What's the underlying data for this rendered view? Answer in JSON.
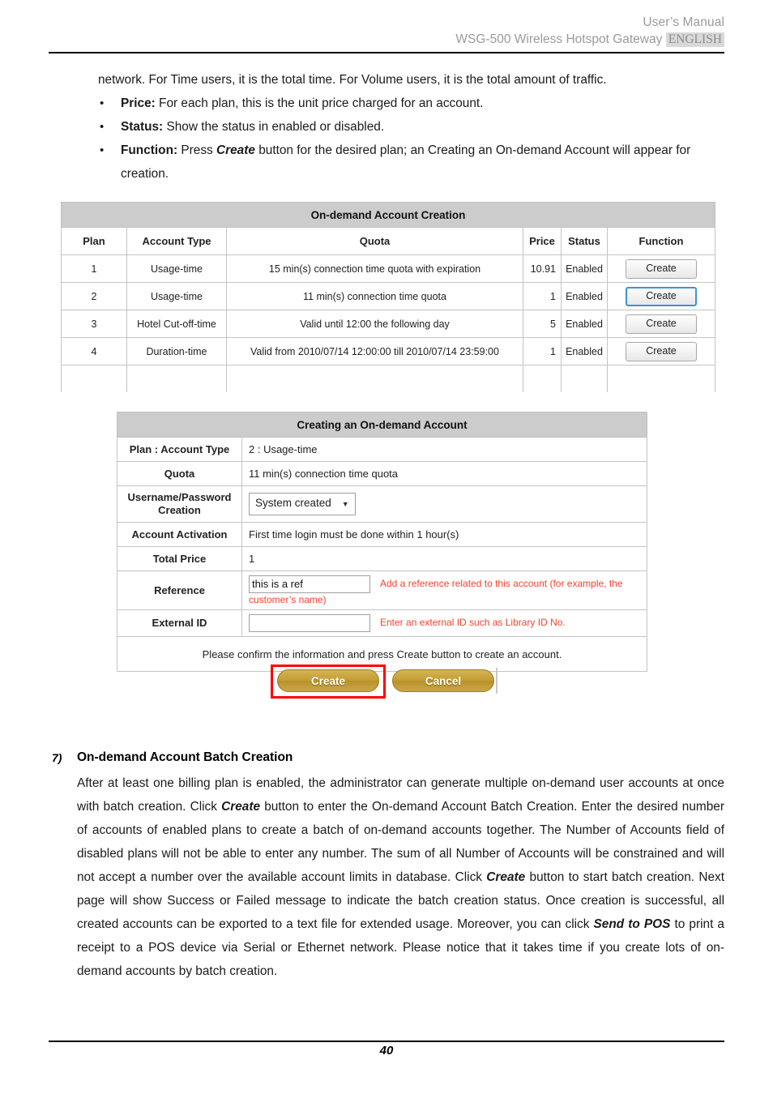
{
  "header": {
    "line1": "User’s Manual",
    "line2_product": "WSG-500 Wireless Hotspot Gateway",
    "language_badge": "ENGLISH"
  },
  "intro": {
    "continuation": "network. For Time users, it is the total time. For Volume users, it is the total amount of traffic.",
    "bullets": [
      {
        "marker": "•",
        "term": "Price:",
        "text": " For each plan, this is the unit price charged for an account."
      },
      {
        "marker": "•",
        "term": "Status:",
        "text": " Show the status in enabled or disabled."
      }
    ],
    "function_bullet": {
      "marker": "•",
      "term": "Function:",
      "part1": " Press ",
      "emphasis": "Create",
      "part2": " button for the desired plan; an Creating an On-demand Account will appear for creation."
    }
  },
  "table_ondemand": {
    "title": "On-demand Account Creation",
    "columns": [
      "Plan",
      "Account Type",
      "Quota",
      "Price",
      "Status",
      "Function"
    ],
    "rows": [
      {
        "plan": "1",
        "account_type": "Usage-time",
        "quota": "15 min(s) connection time quota with expiration",
        "price": "10.91",
        "status": "Enabled",
        "function": "Create",
        "focused": false
      },
      {
        "plan": "2",
        "account_type": "Usage-time",
        "quota": "11 min(s) connection time quota",
        "price": "1",
        "status": "Enabled",
        "function": "Create",
        "focused": true
      },
      {
        "plan": "3",
        "account_type": "Hotel Cut-off-time",
        "quota": "Valid until 12:00 the following day",
        "price": "5",
        "status": "Enabled",
        "function": "Create",
        "focused": false
      },
      {
        "plan": "4",
        "account_type": "Duration-time",
        "quota": "Valid from 2010/07/14 12:00:00 till 2010/07/14 23:59:00",
        "price": "1",
        "status": "Enabled",
        "function": "Create",
        "focused": false
      }
    ]
  },
  "table_creating": {
    "title": "Creating an On-demand Account",
    "fields": {
      "plan_account_type_label": "Plan : Account Type",
      "plan_account_type_value": "2 : Usage-time",
      "quota_label": "Quota",
      "quota_value": "11 min(s) connection time quota",
      "username_password_label": "Username/Password Creation",
      "username_password_value": "System created",
      "account_activation_label": "Account Activation",
      "account_activation_value": "First time login must be done within 1 hour(s)",
      "total_price_label": "Total Price",
      "total_price_value": "1",
      "reference_label": "Reference",
      "reference_value": "this is a ref",
      "reference_hint": "Add a reference related to this account (for example, the customer’s name)",
      "external_id_label": "External ID",
      "external_id_value": "",
      "external_id_hint": "Enter an external ID such as Library ID No."
    },
    "confirm_note": "Please confirm the information and press Create button to create an account."
  },
  "action_buttons": {
    "create": "Create",
    "cancel": "Cancel",
    "highlight_color": "#ff0000",
    "button_color": "#c49e33"
  },
  "section": {
    "number": "7)",
    "heading": "On-demand Account Batch Creation",
    "paragraph_part1": "After at least one billing plan is enabled, the administrator can generate multiple on-demand user accounts at once with batch creation. Click ",
    "emphasis1": "Create",
    "paragraph_part2": " button to enter the On-demand Account Batch Creation. Enter the desired number of accounts of enabled plans to create a batch of on-demand accounts together. The Number of Accounts field of disabled plans will not be able to enter any number. The sum of all Number of Accounts will be constrained and will not accept a number over the available account limits in database. Click ",
    "emphasis2": "Create",
    "paragraph_part3": " button to start batch creation. Next page will show Success or Failed message to indicate the batch creation status. Once creation is successful, all created accounts can be exported to a text file for extended usage. Moreover, you can click ",
    "emphasis3": "Send to POS",
    "paragraph_part4": " to print a receipt to a POS device via Serial or Ethernet network. Please notice that it takes time if you create lots of on-demand accounts by batch creation."
  },
  "footer": {
    "page_number": "40"
  }
}
